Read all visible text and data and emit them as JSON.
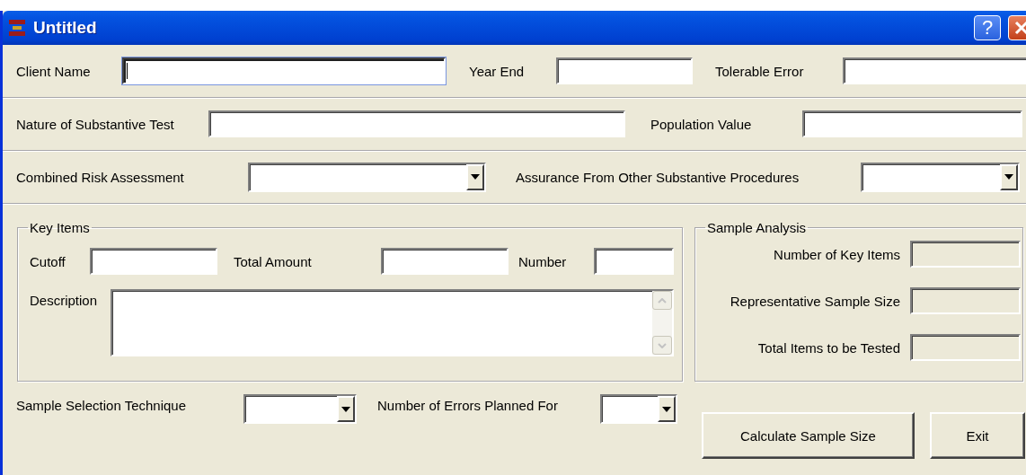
{
  "window": {
    "title": "Untitled",
    "help_button": "?"
  },
  "top_rows": [
    {
      "fields": [
        {
          "label": "Client Name",
          "kind": "text",
          "focused": true
        },
        {
          "label": "Year End",
          "kind": "text",
          "focused": false
        },
        {
          "label": "Tolerable Error",
          "kind": "text",
          "focused": false
        }
      ]
    },
    {
      "fields": [
        {
          "label": "Nature of Substantive Test",
          "kind": "text",
          "focused": false
        },
        {
          "label": "Population Value",
          "kind": "text",
          "focused": false
        }
      ]
    },
    {
      "fields": [
        {
          "label": "Combined Risk Assessment",
          "kind": "combo"
        },
        {
          "label": "Assurance From Other Substantive Procedures",
          "kind": "combo"
        }
      ]
    }
  ],
  "key_items": {
    "title": "Key Items",
    "fields": [
      {
        "label": "Cutoff"
      },
      {
        "label": "Total Amount"
      },
      {
        "label": "Number"
      }
    ],
    "description": {
      "label": "Description"
    }
  },
  "sample_analysis": {
    "title": "Sample Analysis",
    "fields": [
      {
        "label": "Number of Key Items",
        "disabled": true
      },
      {
        "label": "Representative Sample Size",
        "disabled": true
      },
      {
        "label": "Total Items to be Tested",
        "disabled": true
      }
    ]
  },
  "bottom_fields": [
    {
      "label": "Sample Selection Technique",
      "kind": "combo"
    },
    {
      "label": "Number of Errors Planned For",
      "kind": "combo"
    }
  ],
  "buttons": [
    "Calculate Sample Size",
    "Exit"
  ]
}
